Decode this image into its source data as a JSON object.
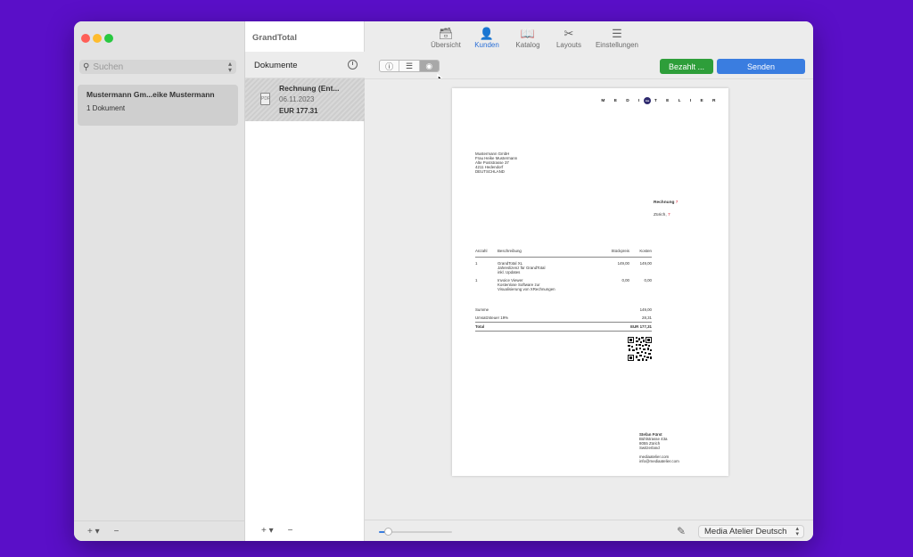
{
  "app": {
    "title": "GrandTotal"
  },
  "sidebar": {
    "search_placeholder": "Suchen",
    "customer": {
      "name": "Mustermann Gm...eike Mustermann",
      "count": "1 Dokument"
    },
    "add_label": "+ ▾",
    "remove_label": "−"
  },
  "doclist": {
    "title": "Dokumente",
    "item": {
      "title": "Rechnung (Ent...",
      "date": "06.11.2023",
      "amount": "EUR 177.31",
      "file_icon_text": "PDF"
    },
    "add_label": "+ ▾",
    "remove_label": "−"
  },
  "toolbar": {
    "tabs": [
      {
        "label": "Übersicht",
        "icon": "tray-icon"
      },
      {
        "label": "Kunden",
        "icon": "person-icon"
      },
      {
        "label": "Katalog",
        "icon": "book-icon"
      },
      {
        "label": "Layouts",
        "icon": "scissors-icon"
      },
      {
        "label": "Einstellungen",
        "icon": "sliders-icon"
      }
    ],
    "active_tab": "Kunden",
    "paid_label": "Bezahlt ...",
    "send_label": "Senden",
    "paid_color": "#2e9e3a",
    "send_color": "#3a7de0"
  },
  "view_segments": [
    "info",
    "list",
    "preview"
  ],
  "invoice": {
    "logo_left": "M E D I",
    "logo_mark": "ma",
    "logo_right": "T E L I E R",
    "recipient": [
      "Mustermann GmbH",
      "Frau Heike Mustermann",
      "Alte Poststrasse 37",
      "4211 Hedendorf",
      "DEUTSCHLAND"
    ],
    "doc_type": "Rechnung",
    "doc_number": "7",
    "city": "Zürich,",
    "city_suffix": "7",
    "headers": {
      "qty": "Anzahl",
      "desc": "Beschreibung",
      "unit": "Stückpreis",
      "total": "Kosten"
    },
    "items": [
      {
        "qty": "1",
        "desc1": "GrandTotal XL",
        "desc2": "Jahreslizenz für GrandTotal",
        "desc3": "inkl. Updates",
        "unit": "149,00",
        "total": "149,00"
      },
      {
        "qty": "1",
        "desc1": "Invoice Viewer",
        "desc2": "Kostenlose Software zur",
        "desc3": "Visualisierung von XRechnungen",
        "unit": "0,00",
        "total": "0,00"
      }
    ],
    "sum_label": "Summe",
    "sum_value": "149,00",
    "vat_label": "Umsatzsteuer 19%",
    "vat_value": "28,31",
    "total_label": "Total",
    "total_value": "EUR 177,31",
    "sender": [
      "Stefan Fürst",
      "Bühlstrasse 43a",
      "8055 Zürich",
      "Switzerland",
      "",
      "mediaatelier.com",
      "info@mediaatelier.com"
    ]
  },
  "bottom": {
    "zoom_fraction": 0.12,
    "language": "Media Atelier Deutsch"
  }
}
